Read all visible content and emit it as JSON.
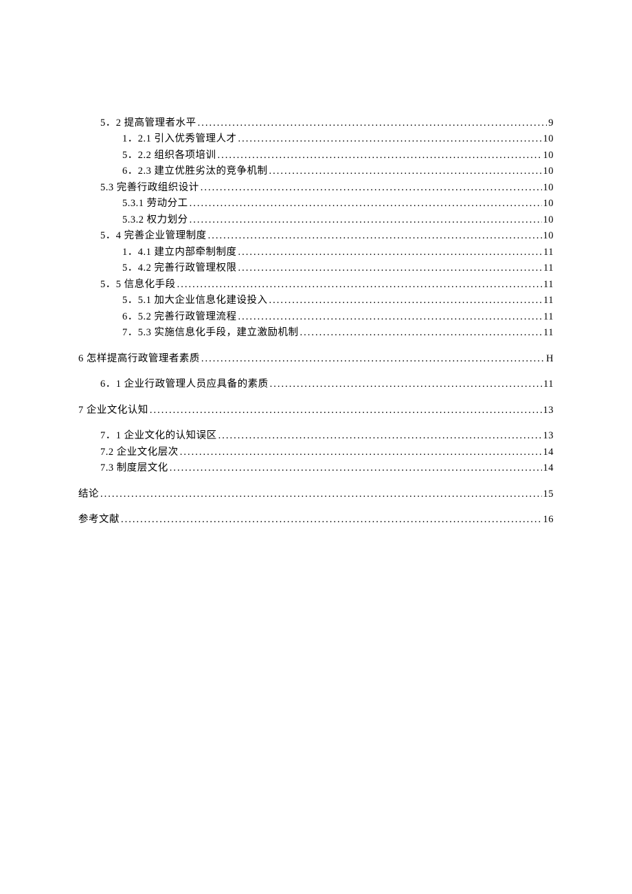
{
  "toc": [
    {
      "lines": [
        {
          "indent": 1,
          "label": "5．2 提高管理者水平",
          "page": "9"
        },
        {
          "indent": 2,
          "label": "1．2.1 引入优秀管理人才",
          "page": "10"
        },
        {
          "indent": 2,
          "label": "5．2.2 组织各项培训",
          "page": "10"
        },
        {
          "indent": 2,
          "label": "6．2.3 建立优胜劣汰的竞争机制",
          "page": "10"
        },
        {
          "indent": 1,
          "label": "5.3 完善行政组织设计",
          "page": "10"
        },
        {
          "indent": 2,
          "label": "5.3.1 劳动分工",
          "page": "10"
        },
        {
          "indent": 2,
          "label": "5.3.2 权力划分",
          "page": "10"
        },
        {
          "indent": 1,
          "label": "5．4 完善企业管理制度",
          "page": "10"
        },
        {
          "indent": 2,
          "label": "1．4.1 建立内部牵制制度",
          "page": "11"
        },
        {
          "indent": 2,
          "label": "5．4.2 完善行政管理权限",
          "page": "11"
        },
        {
          "indent": 1,
          "label": "5．5 信息化手段",
          "page": "11"
        },
        {
          "indent": 2,
          "label": "5．5.1 加大企业信息化建设投入",
          "page": "11"
        },
        {
          "indent": 2,
          "label": "6．5.2 完善行政管理流程",
          "page": "11"
        },
        {
          "indent": 2,
          "label": "7．5.3 实施信息化手段，建立激励机制",
          "page": "11"
        }
      ]
    },
    {
      "lines": [
        {
          "indent": 0,
          "label": "6 怎样提高行政管理者素质",
          "page": "H"
        }
      ]
    },
    {
      "lines": [
        {
          "indent": 1,
          "label": "6．1 企业行政管理人员应具备的素质",
          "page": "11"
        }
      ]
    },
    {
      "lines": [
        {
          "indent": 0,
          "label": "7 企业文化认知",
          "page": "13"
        }
      ]
    },
    {
      "lines": [
        {
          "indent": 1,
          "label": "7．1 企业文化的认知误区",
          "page": "13"
        },
        {
          "indent": 1,
          "label": "7.2 企业文化层次",
          "page": "14"
        },
        {
          "indent": 1,
          "label": "7.3 制度层文化",
          "page": "14"
        }
      ]
    },
    {
      "lines": [
        {
          "indent": 0,
          "label": "结论",
          "page": "15"
        }
      ]
    },
    {
      "lines": [
        {
          "indent": 0,
          "label": "参考文献",
          "page": "16"
        }
      ]
    }
  ]
}
